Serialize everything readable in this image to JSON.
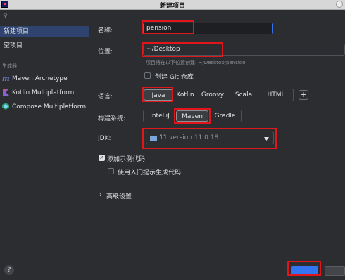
{
  "window": {
    "title": "新建项目",
    "help_glyph": "?"
  },
  "sidebar": {
    "search_glyph": "⚲",
    "items": [
      {
        "label": "新建项目"
      },
      {
        "label": "空项目"
      }
    ],
    "generators_section": "生成器",
    "generators": [
      {
        "label": "Maven Archetype",
        "icon": "maven-m"
      },
      {
        "label": "Kotlin Multiplatform",
        "icon": "kotlin-k"
      },
      {
        "label": "Compose Multiplatform",
        "icon": "compose-logo"
      }
    ]
  },
  "form": {
    "name_label": "名称:",
    "name_value": "pension",
    "location_label": "位置:",
    "location_value": "~/Desktop",
    "location_hint": "项目将在以下位置创建: ~/Desktop/pension",
    "git_label": "创建 Git 仓库",
    "git_checked": false,
    "language_label": "语言:",
    "languages": [
      "Java",
      "Kotlin",
      "Groovy",
      "Scala",
      "HTML"
    ],
    "language_selected": "Java",
    "add_language_glyph": "+",
    "build_label": "构建系统:",
    "build_systems": [
      "IntelliJ",
      "Maven",
      "Gradle"
    ],
    "build_selected": "Maven",
    "jdk_label": "JDK:",
    "jdk_version": "11",
    "jdk_detail": "version 11.0.18",
    "sample_code_label": "添加示例代码",
    "sample_code_checked": true,
    "onboarding_label": "使用入门提示生成代码",
    "onboarding_checked": false,
    "advanced_label": "高级设置"
  },
  "colors": {
    "accent_selection": "#2e436e",
    "highlight_box": "#e0161b",
    "background": "#2b2d30"
  }
}
